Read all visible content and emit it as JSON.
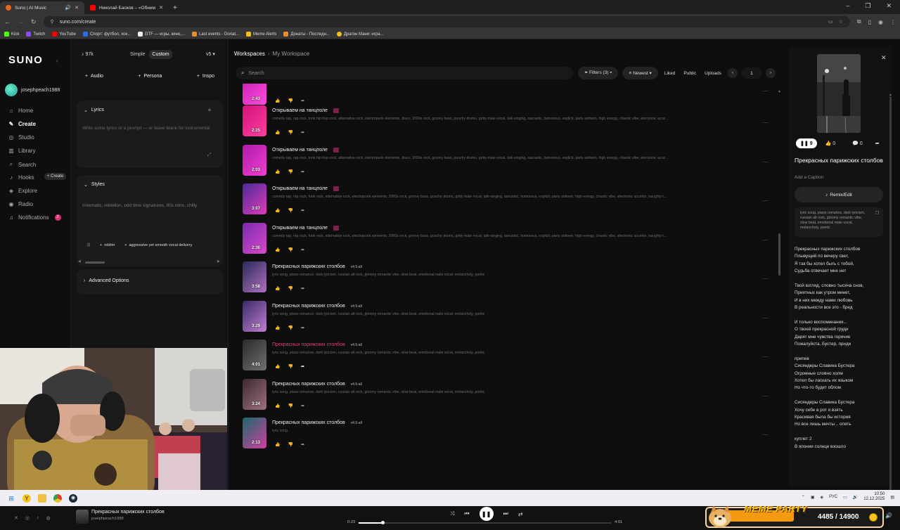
{
  "browser": {
    "tabs": [
      {
        "title": "Suno | AI Music",
        "color": "#e8671f",
        "active": true
      },
      {
        "title": "Николай Басков – «Обниму тебя»",
        "color": "#ff0000",
        "active": false
      }
    ],
    "url": "suno.com/create",
    "bookmarks": [
      {
        "label": "Kick",
        "color": "#53fc18"
      },
      {
        "label": "Twitch",
        "color": "#9146ff"
      },
      {
        "label": "YouTube",
        "color": "#ff0000"
      },
      {
        "label": "Спорт: футбол, хок...",
        "color": "#2a6ee0"
      },
      {
        "label": "DTF — игры, кино,...",
        "color": "#eeeeee"
      },
      {
        "label": "Last events - Donat...",
        "color": "#f08a24"
      },
      {
        "label": "Meme Alerts",
        "color": "#f0c020"
      },
      {
        "label": "Донаты - Последн...",
        "color": "#f08a24"
      },
      {
        "label": "Драгон Мани: игра...",
        "color": "#f0c020"
      }
    ]
  },
  "sidebar": {
    "logo": "SUNO",
    "username": "josephpeach1988",
    "items": [
      {
        "label": "Home",
        "icon": "home-icon",
        "glyph": "⌂"
      },
      {
        "label": "Create",
        "icon": "create-icon",
        "glyph": "✎",
        "active": true
      },
      {
        "label": "Studio",
        "icon": "studio-icon",
        "glyph": "◎"
      },
      {
        "label": "Library",
        "icon": "library-icon",
        "glyph": "▥"
      },
      {
        "label": "Search",
        "icon": "search-icon",
        "glyph": "⌕"
      },
      {
        "label": "Hooks",
        "icon": "hooks-icon",
        "glyph": "♪"
      },
      {
        "label": "Explore",
        "icon": "explore-icon",
        "glyph": "◈"
      },
      {
        "label": "Radio",
        "icon": "radio-icon",
        "glyph": "◉"
      },
      {
        "label": "Notifications",
        "icon": "bell-icon",
        "glyph": "♫"
      }
    ],
    "hooks_create": "+ Create",
    "notif_count": "2"
  },
  "create": {
    "credits": "97k",
    "mode_simple": "Simple",
    "mode_custom": "Custom",
    "version": "v5",
    "add_audio": "Audio",
    "add_persona": "Persona",
    "add_inspo": "Inspo",
    "lyrics_label": "Lyrics",
    "lyrics_placeholder": "Write some lyrics or a prompt — or leave blank for instrumental",
    "styles_label": "Styles",
    "styles_text": "cinematic, rebellion, odd time signatures, 80s retro, chilly",
    "style_chips": [
      "riddim",
      "aggressive yet smooth vocal delivery"
    ],
    "advanced": "Advanced Options"
  },
  "main": {
    "crumb_root": "Workspaces",
    "crumb_current": "My Workspace",
    "search_placeholder": "Search",
    "filters": "Filters (3)",
    "sort": "Newest",
    "liked": "Liked",
    "public": "Public",
    "uploads": "Uploads",
    "page": "1",
    "songs": [
      {
        "title": "",
        "duration": "2:43",
        "tags": "",
        "version": "",
        "explicit": false,
        "thumb": [
          "#c21ab8",
          "#ff4fd8"
        ]
      },
      {
        "title": "Открываем на танцполе",
        "duration": "2:25",
        "tags": "comedy rap, rap rock, funk hip hop rock, alternative rock, electropunk elements, disco, 2000s rock, groovy bass, punchy drums, gritty male vocal, talk-singing, sarcastic, humorous, explicit, party anthem, high energy, chaotic vibe, electronic acce...",
        "version": "",
        "explicit": true,
        "thumb": [
          "#d0127d",
          "#ff3fa0"
        ]
      },
      {
        "title": "Открываем на танцполе",
        "duration": "2:03",
        "tags": "comedy rap, rap rock, funk hip hop rock, alternative rock, electropunk elements, disco, 2000s rock, groovy bass, punchy drums, gritty male vocal, talk-singing, sarcastic, humorous, explicit, party anthem, high energy, chaotic vibe, electronic acce...",
        "version": "",
        "explicit": true,
        "thumb": [
          "#b01aa8",
          "#f040d0"
        ]
      },
      {
        "title": "Открываем на танцполе",
        "duration": "3:07",
        "tags": "comedy rap, rap rock, funk rock, alternative rock, electropunk elements, 2000s rock, groovy bass, punchy drums, gritty male vocal, talk-singing, sarcastic, humorous, explicit, party anthem, high energy, chaotic vibe, electronic accents, naughty t...",
        "version": "",
        "explicit": true,
        "thumb": [
          "#4a2a9a",
          "#e03cb8"
        ]
      },
      {
        "title": "Открываем на танцполе",
        "duration": "2:30",
        "tags": "comedy rap, rap rock, funk rock, alternative rock, electropunk elements, 2000s rock, groovy bass, punchy drums, gritty male vocal, talk-singing, sarcastic, humorous, explicit, party anthem, high energy, chaotic vibe, electronic accents, naughty t...",
        "version": "",
        "explicit": true,
        "thumb": [
          "#7a2ab0",
          "#d84ac8"
        ]
      },
      {
        "title": "Прекрасных парижских столбов",
        "duration": "3:58",
        "tags": "lyric song, piano romance, dark lyricism, russian alt rock, gloomy romantic vibe, slow beat, emotional male vocal, melancholy, poetic",
        "version": "v4.5-all",
        "explicit": false,
        "thumb": [
          "#2a2a5a",
          "#b070c0"
        ]
      },
      {
        "title": "Прекрасных парижских столбов",
        "duration": "3:29",
        "tags": "lyric song, piano romance, dark lyricism, russian alt rock, gloomy romantic vibe, slow beat, emotional male vocal, melancholy, poetic",
        "version": "v4.5-all",
        "explicit": false,
        "thumb": [
          "#3a2a6a",
          "#c080d0"
        ]
      },
      {
        "title": "Прекрасных парижских столбов",
        "duration": "4:01",
        "tags": "lyric song, piano romance, dark lyricism, russian alt rock, gloomy romantic vibe, slow beat, emotional male vocal, melancholy, poetic",
        "version": "v4.5-all",
        "explicit": false,
        "playing": true,
        "thumb": [
          "#2a2a2a",
          "#707070"
        ]
      },
      {
        "title": "Прекрасных парижских столбов",
        "duration": "3:24",
        "tags": "lyric song, piano romance, dark lyricism, russian alt rock, gloomy romantic vibe, slow beat, emotional male vocal, melancholy, poetic",
        "version": "v4.5-all",
        "explicit": false,
        "thumb": [
          "#3a2a30",
          "#a07080"
        ]
      },
      {
        "title": "Прекрасных парижских столбов",
        "duration": "2:13",
        "tags": "lyric song",
        "version": "v4.5-all",
        "explicit": false,
        "thumb": [
          "#1a6a6a",
          "#d040a0"
        ]
      }
    ]
  },
  "detail": {
    "plays": "9",
    "likes": "0",
    "comments": "0",
    "title": "Прекрасных парижских столбов",
    "caption": "Add a Caption",
    "remix": "Remix/Edit",
    "styles": "lyric song, piano romance, dark lyricism, russian alt rock, gloomy romantic vibe, slow beat, emotional male vocal, melancholy, poetic",
    "lyrics": [
      "Прекрасных парижских столбов",
      "Плывущий по вечеру свет,",
      "Я так бы хотел быть с тобой,",
      "Судьба отвечает мне нет",
      "",
      "Твой взгляд, словно тысяча снов,",
      "Приятных как утром минет,",
      "И в них между нами любовь",
      "В реальности все это - бред",
      "",
      "И только воспоминания...",
      "О твоей прекрасной груди",
      "Дарят мне чувства горячие",
      "Пожалуйста, Бустер, приди",
      "",
      "припев",
      "Сисяндеры Славика Бустера",
      "Огромные словно холм",
      "Хотел бы ласкать их языком",
      "Но что-то будет облом",
      "",
      "Сисяндеры Славика Бустера",
      "Хочу себе в рот я взять",
      "Красивая была бы история",
      "Но все лишь мечты .. опять",
      "",
      "куплет 2",
      "В японии солнце взошло"
    ]
  },
  "player": {
    "title": "Прекрасных парижских столбов",
    "user": "josephpeach1988",
    "current": "0:23",
    "total": "4:01",
    "progress": 0.095
  },
  "overlay": {
    "meme_title": "MEME PARTY",
    "meme_count": "4485 / 14900",
    "meme_progress": 0.3
  },
  "taskbar": {
    "lang": "РУС",
    "time": "10:50",
    "date": "12.12.2025"
  },
  "colors": {
    "accent": "#e0407a",
    "bg": "#0e0e0e"
  }
}
